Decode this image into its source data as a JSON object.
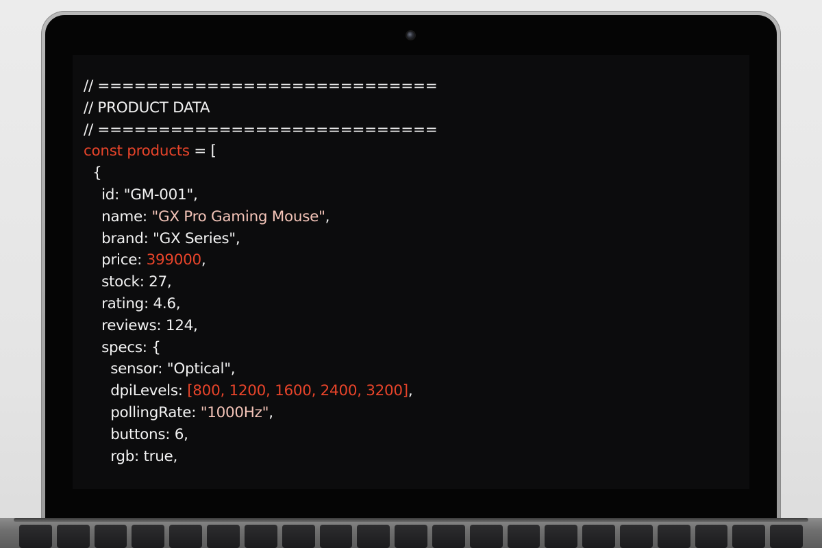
{
  "editor": {
    "lines": [
      [
        {
          "t": "// ============================",
          "c": "plain"
        }
      ],
      [
        {
          "t": "// PRODUCT DATA",
          "c": "plain"
        }
      ],
      [
        {
          "t": "// ============================",
          "c": "plain"
        }
      ],
      [
        {
          "t": "const products",
          "c": "kw"
        },
        {
          "t": " = [",
          "c": "plain"
        }
      ],
      [
        {
          "t": "  {",
          "c": "plain"
        }
      ],
      [
        {
          "t": "    id: \"GM-001\",",
          "c": "plain"
        }
      ],
      [
        {
          "t": "    name: ",
          "c": "plain"
        },
        {
          "t": "\"GX Pro Gaming Mouse\"",
          "c": "str"
        },
        {
          "t": ",",
          "c": "plain"
        }
      ],
      [
        {
          "t": "    brand: \"GX Series\",",
          "c": "plain"
        }
      ],
      [
        {
          "t": "    price: ",
          "c": "plain"
        },
        {
          "t": "399000",
          "c": "num"
        },
        {
          "t": ",",
          "c": "plain"
        }
      ],
      [
        {
          "t": "    stock: 27,",
          "c": "plain"
        }
      ],
      [
        {
          "t": "    rating: 4.6,",
          "c": "plain"
        }
      ],
      [
        {
          "t": "    reviews: 124,",
          "c": "plain"
        }
      ],
      [
        {
          "t": "    specs: {",
          "c": "plain"
        }
      ],
      [
        {
          "t": "      sensor: \"Optical\",",
          "c": "plain"
        }
      ],
      [
        {
          "t": "      dpiLevels: ",
          "c": "plain"
        },
        {
          "t": "[800, 1200, 1600, 2400, 3200]",
          "c": "arr"
        },
        {
          "t": ",",
          "c": "plain"
        }
      ],
      [
        {
          "t": "      pollingRate: ",
          "c": "plain"
        },
        {
          "t": "\"1000Hz\"",
          "c": "str"
        },
        {
          "t": ",",
          "c": "plain"
        }
      ],
      [
        {
          "t": "      buttons: 6,",
          "c": "plain"
        }
      ],
      [
        {
          "t": "      rgb: true,",
          "c": "plain"
        }
      ]
    ]
  },
  "colors": {
    "keyword": "#e8442a",
    "string": "#f4c4b8",
    "number": "#e8442a",
    "text": "#f2f2f2",
    "background": "#0c0c0d"
  },
  "keyboard": {
    "keys": [
      "",
      "",
      "",
      "",
      "",
      "",
      "",
      "",
      "",
      "",
      "",
      "",
      "",
      "",
      "",
      "",
      "",
      "",
      "",
      "",
      ""
    ]
  }
}
